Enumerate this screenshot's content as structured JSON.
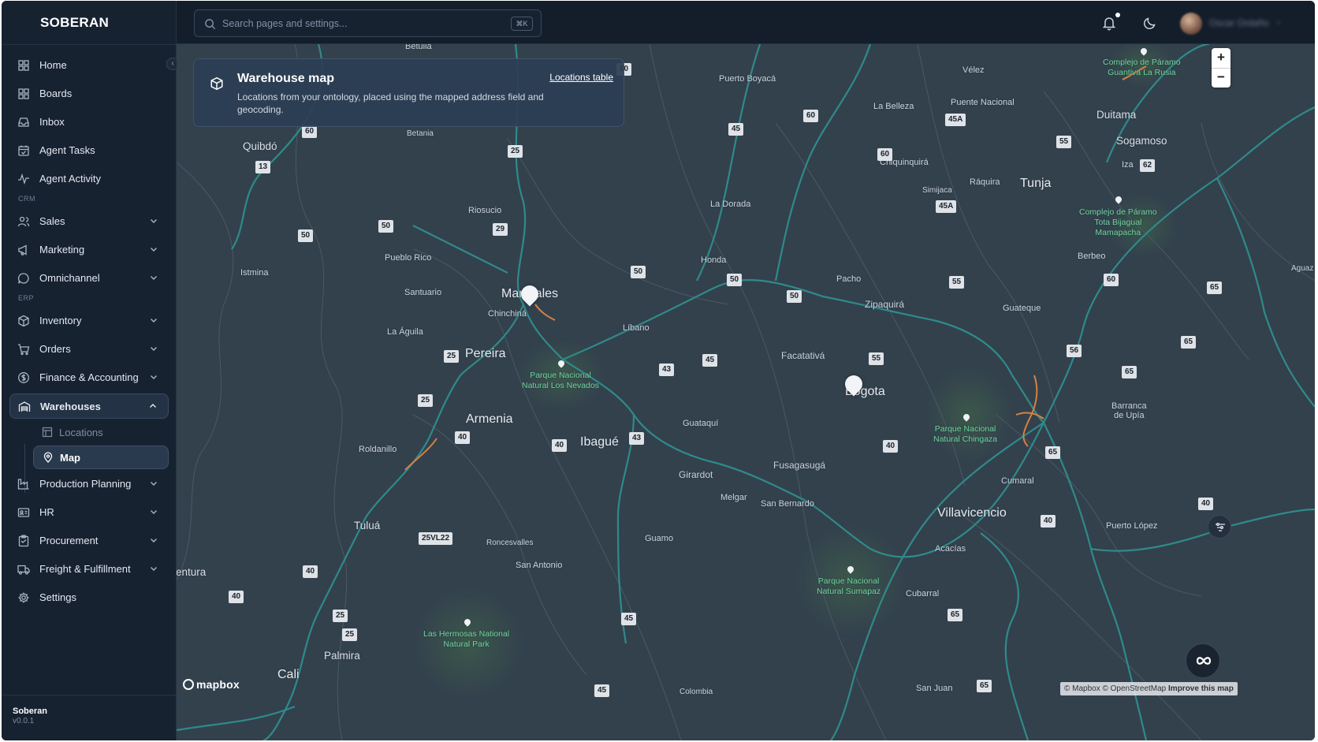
{
  "brand": "SOBERAN",
  "search": {
    "placeholder": "Search pages and settings...",
    "shortcut": "⌘K"
  },
  "user": {
    "name": "Oscar Ordaño"
  },
  "nav": {
    "home": "Home",
    "boards": "Boards",
    "inbox": "Inbox",
    "agent_tasks": "Agent Tasks",
    "agent_activity": "Agent Activity",
    "section_crm": "CRM",
    "sales": "Sales",
    "marketing": "Marketing",
    "omnichannel": "Omnichannel",
    "section_erp": "ERP",
    "inventory": "Inventory",
    "orders": "Orders",
    "finance": "Finance & Accounting",
    "warehouses": "Warehouses",
    "locations": "Locations",
    "map": "Map",
    "production": "Production Planning",
    "hr": "HR",
    "procurement": "Procurement",
    "freight": "Freight & Fulfillment",
    "settings": "Settings"
  },
  "footer": {
    "org": "Soberan",
    "version": "v0.0.1"
  },
  "card": {
    "title": "Warehouse map",
    "description": "Locations from your ontology, placed using the mapped address field and geocoding.",
    "link": "Locations table"
  },
  "map": {
    "zoom_in": "+",
    "zoom_out": "−",
    "logo": "mapbox",
    "attribution": "© Mapbox © OpenStreetMap",
    "improve": "Improve this map",
    "places": {
      "quibdo": "Quibdó",
      "betulia": "Betulia",
      "betania": "Betania",
      "riosucio": "Riosucio",
      "pueblo_rico": "Pueblo Rico",
      "istmina": "Istmina",
      "santuario": "Santuario",
      "manizales": "Manizales",
      "chinchina": "Chinchiná",
      "la_aguila": "La Águila",
      "pereira": "Pereira",
      "armenia": "Armenia",
      "roldanillo": "Roldanillo",
      "tulua": "Tuluá",
      "ventura": "entura",
      "palmira": "Palmira",
      "cali": "Cali",
      "roncesvalles": "Roncesvalles",
      "san_antonio": "San Antonio",
      "ibague": "Ibagué",
      "libano": "Líbano",
      "honda": "Honda",
      "la_dorada": "La Dorada",
      "puerto_boyaca": "Puerto Boyacá",
      "guataqui": "Guataquí",
      "girardot": "Girardot",
      "melgar": "Melgar",
      "guamo": "Guamo",
      "colombia": "Colombia",
      "facatativa": "Facatativá",
      "bogota": "Bogota",
      "fusagasuga": "Fusagasugá",
      "san_bernardo": "San Bernardo",
      "pacho": "Pacho",
      "zipaquira": "Zipaquirá",
      "la_belleza": "La Belleza",
      "puente_nacional": "Puente Nacional",
      "velez": "Vélez",
      "chiquinquira": "Chiquinquirá",
      "simijaca": "Simijaca",
      "raquira": "Ráquira",
      "tunja": "Tunja",
      "duitama": "Duitama",
      "sogamoso": "Sogamoso",
      "iza": "Iza",
      "berbeo": "Berbeo",
      "guateque": "Guateque",
      "villavicencio": "Villavicencio",
      "acacias": "Acacías",
      "cubarral": "Cubarral",
      "cumaral": "Cumaral",
      "puerto_lopez": "Puerto López",
      "barranca_de_upia": "Barranca\nde Upía",
      "san_juan": "San Juan",
      "aguaz": "Aguaz"
    },
    "parks": {
      "los_nevados": "Parque Nacional\nNatural Los Nevados",
      "chingaza": "Parque Nacional\nNatural Chingaza",
      "sumapaz": "Parque Nacional\nNatural Sumapaz",
      "las_hermosas": "Las Hermosas National\nNatural Park",
      "guantiva": "Complejo de Páramo\nGuantiva La Rusia",
      "tota": "Complejo de Páramo\nTota Bijagual\nMamapacha"
    },
    "shields": {
      "s60a": "60",
      "s60b": "60",
      "s60c": "60",
      "s60d": "60",
      "s60e": "60",
      "s45a1": "45A",
      "s45a2": "45A",
      "s55a": "55",
      "s55b": "55",
      "s55c": "55",
      "s62": "62",
      "s65a": "65",
      "s65b": "65",
      "s65c": "65",
      "s65d": "65",
      "s65e": "65",
      "s65f": "65",
      "s56": "56",
      "s13": "13",
      "s25a": "25",
      "s25b": "25",
      "s25c": "25",
      "s25d": "25",
      "s25e": "25",
      "s29": "29",
      "s50a": "50",
      "s50b": "50",
      "s50c": "50",
      "s50d": "50",
      "s50e": "50",
      "s45a": "45",
      "s45b": "45",
      "s45c": "45",
      "s45d": "45",
      "s43a": "43",
      "s43b": "43",
      "s40a": "40",
      "s40b": "40",
      "s40c": "40",
      "s40d": "40",
      "s40e": "40",
      "s40f": "40",
      "s40g": "40",
      "s25vl22": "25VL22"
    }
  }
}
